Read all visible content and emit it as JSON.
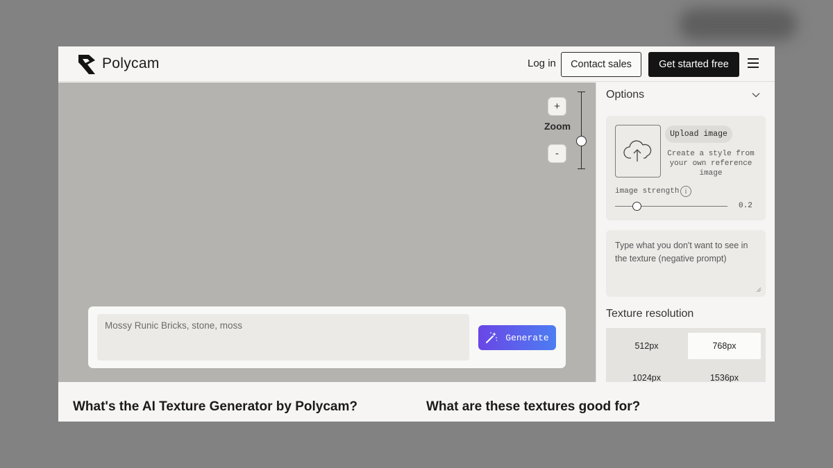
{
  "header": {
    "brand": "Polycam",
    "login_label": "Log in",
    "contact_label": "Contact sales",
    "start_label": "Get started free"
  },
  "canvas": {
    "zoom_in_label": "+",
    "zoom_out_label": "-",
    "zoom_label": "Zoom",
    "prompt": {
      "value": "",
      "placeholder": "Mossy Runic Bricks, stone, moss"
    },
    "generate_label": "Generate"
  },
  "options": {
    "title": "Options",
    "upload": {
      "button_label": "Upload image",
      "description": "Create a style from your own reference image",
      "strength_label": "image strength",
      "strength_value": "0.2",
      "info_glyph": "i"
    },
    "negative_prompt": {
      "value": "",
      "placeholder": "Type what you don't want to see in the texture (negative prompt)"
    },
    "resolution": {
      "title": "Texture resolution",
      "options": [
        "512px",
        "768px",
        "1024px",
        "1536px"
      ],
      "selected": "768px"
    }
  },
  "sections": {
    "left_heading": "What's the AI Texture Generator by Polycam?",
    "right_heading": "What are these textures good for?"
  },
  "icons": {
    "logo": "polycam-logo-icon",
    "menu": "hamburger-menu-icon",
    "generate": "magic-wand-icon",
    "upload": "cloud-upload-icon",
    "collapse": "chevron-down-icon"
  },
  "colors": {
    "canvas_bg": "#b4b3b0",
    "primary_dark": "#141414",
    "generate_gradient_start": "#6a46e6",
    "generate_gradient_end": "#4d7df2"
  }
}
